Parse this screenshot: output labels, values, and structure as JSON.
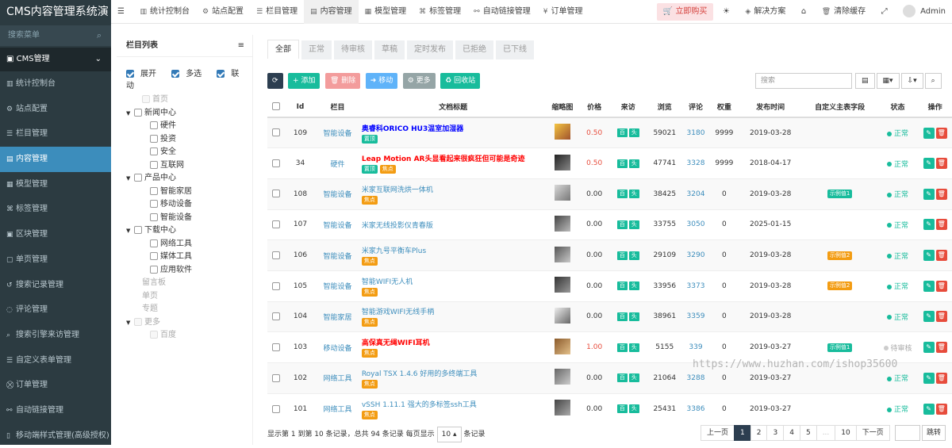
{
  "app": {
    "title": "CMS内容管理系统演",
    "search_placeholder": "搜索菜单"
  },
  "sidebar": {
    "head": "CMS管理",
    "items": [
      {
        "label": "统计控制台",
        "icon": "chart-icon"
      },
      {
        "label": "站点配置",
        "icon": "gear-icon"
      },
      {
        "label": "栏目管理",
        "icon": "list-icon"
      },
      {
        "label": "内容管理",
        "icon": "file-icon"
      },
      {
        "label": "模型管理",
        "icon": "grid-icon"
      },
      {
        "label": "标签管理",
        "icon": "tag-icon"
      },
      {
        "label": "区块管理",
        "icon": "block-icon"
      },
      {
        "label": "单页管理",
        "icon": "page-icon"
      },
      {
        "label": "搜索记录管理",
        "icon": "history-icon"
      },
      {
        "label": "评论管理",
        "icon": "comment-icon"
      },
      {
        "label": "搜索引擎来访管理",
        "icon": "search-icon"
      },
      {
        "label": "自定义表单管理",
        "icon": "form-icon"
      },
      {
        "label": "订单管理",
        "icon": "cart-icon"
      },
      {
        "label": "自动链接管理",
        "icon": "link-icon"
      },
      {
        "label": "移动端样式管理(高级授权)",
        "icon": "mobile-icon"
      }
    ]
  },
  "topbar": {
    "menu": "☰",
    "tabs": [
      "统计控制台",
      "站点配置",
      "栏目管理",
      "内容管理",
      "模型管理",
      "标签管理",
      "自动链接管理",
      "订单管理"
    ],
    "buy": "立即购买",
    "solutions": "解决方案",
    "clear_cache": "清除缓存",
    "user": "Admin"
  },
  "tree": {
    "title": "栏目列表",
    "opt_expand": "展开",
    "opt_multi": "多选",
    "opt_link": "联动",
    "nodes": [
      "首页",
      "新闻中心",
      "硬件",
      "投资",
      "安全",
      "互联网",
      "产品中心",
      "智能家居",
      "移动设备",
      "智能设备",
      "下载中心",
      "网络工具",
      "媒体工具",
      "应用软件",
      "留言板",
      "单页",
      "专题",
      "更多",
      "百度"
    ]
  },
  "status_tabs": [
    "全部",
    "正常",
    "待审核",
    "草稿",
    "定时发布",
    "已拒绝",
    "已下线"
  ],
  "toolbar": {
    "add": "添加",
    "delete": "删除",
    "move": "移动",
    "more": "更多",
    "recycle": "回收站",
    "search_placeholder": "搜索"
  },
  "columns": [
    "Id",
    "栏目",
    "文档标题",
    "缩略图",
    "价格",
    "来访",
    "浏览",
    "评论",
    "权重",
    "发布时间",
    "自定义主表字段",
    "状态",
    "操作"
  ],
  "badges": {
    "hot": "置顶",
    "focus": "焦点",
    "v1": "百",
    "v2": "头"
  },
  "rows": [
    {
      "id": "109",
      "cat": "智能设备",
      "title": "奥睿科ORICO HU3温室加湿器",
      "style": "blue",
      "tags": [
        "置顶"
      ],
      "price": "0.50",
      "price_red": true,
      "views": "59021",
      "comments": "3180",
      "weight": "9999",
      "date": "2019-03-28",
      "custom": "",
      "status": "正常"
    },
    {
      "id": "34",
      "cat": "硬件",
      "title": "Leap Motion AR头显看起来很疯狂但可能是奇迹",
      "style": "red",
      "tags": [
        "置顶",
        "焦点"
      ],
      "price": "0.50",
      "price_red": true,
      "views": "47741",
      "comments": "3328",
      "weight": "9999",
      "date": "2018-04-17",
      "custom": "",
      "status": "正常"
    },
    {
      "id": "108",
      "cat": "智能设备",
      "title": "米家互联网洗烘一体机",
      "style": "link",
      "tags": [
        "焦点"
      ],
      "price": "0.00",
      "price_red": false,
      "views": "38425",
      "comments": "3204",
      "weight": "0",
      "date": "2019-03-28",
      "custom": "示例值1",
      "custom_color": "g",
      "status": "正常"
    },
    {
      "id": "107",
      "cat": "智能设备",
      "title": "米家无线投影仪青春版",
      "style": "link",
      "tags": [],
      "price": "0.00",
      "price_red": false,
      "views": "33755",
      "comments": "3050",
      "weight": "0",
      "date": "2025-01-15",
      "custom": "",
      "status": "正常"
    },
    {
      "id": "106",
      "cat": "智能设备",
      "title": "米家九号平衡车Plus",
      "style": "link",
      "tags": [
        "焦点"
      ],
      "price": "0.00",
      "price_red": false,
      "views": "29109",
      "comments": "3290",
      "weight": "0",
      "date": "2019-03-28",
      "custom": "示例值2",
      "custom_color": "o",
      "status": "正常"
    },
    {
      "id": "105",
      "cat": "智能设备",
      "title": "智能WIFI无人机",
      "style": "link",
      "tags": [
        "焦点"
      ],
      "price": "0.00",
      "price_red": false,
      "views": "33956",
      "comments": "3373",
      "weight": "0",
      "date": "2019-03-28",
      "custom": "示例值2",
      "custom_color": "o",
      "status": "正常"
    },
    {
      "id": "104",
      "cat": "智能家居",
      "title": "智能游戏WIFI无线手柄",
      "style": "link",
      "tags": [
        "焦点"
      ],
      "price": "0.00",
      "price_red": false,
      "views": "38961",
      "comments": "3359",
      "weight": "0",
      "date": "2019-03-28",
      "custom": "",
      "status": "正常"
    },
    {
      "id": "103",
      "cat": "移动设备",
      "title": "高保真无绳WIFI耳机",
      "style": "red",
      "tags": [
        "焦点"
      ],
      "price": "1.00",
      "price_red": true,
      "views": "5155",
      "comments": "339",
      "weight": "0",
      "date": "2019-03-27",
      "custom": "示例值1",
      "custom_color": "g",
      "status": "待审核",
      "status_gray": true
    },
    {
      "id": "102",
      "cat": "网络工具",
      "title": "Royal TSX 1.4.6 好用的多终端工具",
      "style": "link",
      "tags": [
        "焦点"
      ],
      "price": "0.00",
      "price_red": false,
      "views": "21064",
      "comments": "3288",
      "weight": "0",
      "date": "2019-03-27",
      "custom": "",
      "status": "正常"
    },
    {
      "id": "101",
      "cat": "网络工具",
      "title": "vSSH 1.11.1 强大的多标签ssh工具",
      "style": "link",
      "tags": [
        "焦点"
      ],
      "price": "0.00",
      "price_red": false,
      "views": "25431",
      "comments": "3386",
      "weight": "0",
      "date": "2019-03-27",
      "custom": "",
      "status": "正常"
    }
  ],
  "footer": {
    "info_prefix": "显示第 1 到第 10 条记录，总共 94 条记录 每页显示",
    "page_size": "10",
    "info_suffix": "条记录"
  },
  "pager": {
    "prev": "上一页",
    "pages": [
      "1",
      "2",
      "3",
      "4",
      "5",
      "...",
      "10"
    ],
    "next": "下一页",
    "jump": "跳转"
  },
  "watermark": "https://www.huzhan.com/ishop35600"
}
